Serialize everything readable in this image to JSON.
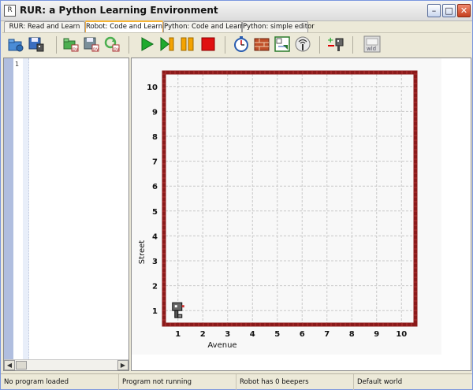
{
  "window": {
    "title": "RUR: a Python Learning Environment",
    "app_icon": "rur-app-icon",
    "controls": [
      "minimize-icon",
      "maximize-icon",
      "close-icon"
    ]
  },
  "tabs": [
    {
      "label": "RUR: Read and Learn",
      "active": false
    },
    {
      "label": "Robot: Code and Learn",
      "active": true
    },
    {
      "label": "Python: Code and Learn",
      "active": false
    },
    {
      "label": "Python: simple editor",
      "active": false
    }
  ],
  "toolbar": {
    "buttons": [
      {
        "icon": "open-world-icon"
      },
      {
        "icon": "save-world-icon"
      },
      {
        "icon": "open-program-icon"
      },
      {
        "icon": "save-program-icon"
      },
      {
        "icon": "reload-program-icon"
      },
      {
        "icon": "run-icon"
      },
      {
        "icon": "step-icon"
      },
      {
        "icon": "pause-icon"
      },
      {
        "icon": "stop-icon"
      },
      {
        "icon": "speed-timer-icon"
      },
      {
        "icon": "edit-walls-icon"
      },
      {
        "icon": "resize-world-icon"
      },
      {
        "icon": "toggle-beepers-icon"
      },
      {
        "icon": "add-robot-icon"
      },
      {
        "icon": "world-info-icon"
      }
    ]
  },
  "editor": {
    "line_numbers": [
      "1"
    ]
  },
  "world": {
    "avenues": [
      "1",
      "2",
      "3",
      "4",
      "5",
      "6",
      "7",
      "8",
      "9",
      "10"
    ],
    "streets": [
      "1",
      "2",
      "3",
      "4",
      "5",
      "6",
      "7",
      "8",
      "9",
      "10"
    ],
    "xlabel": "Avenue",
    "ylabel": "Street",
    "robot": {
      "avenue": 1,
      "street": 1,
      "icon": "robot-icon"
    },
    "wall_color": "#8b1a1a",
    "grid_color": "#c8c8c8"
  },
  "status": {
    "program": "No program loaded",
    "running": "Program not running",
    "beepers": "Robot has 0 beepers",
    "world": "Default world"
  }
}
